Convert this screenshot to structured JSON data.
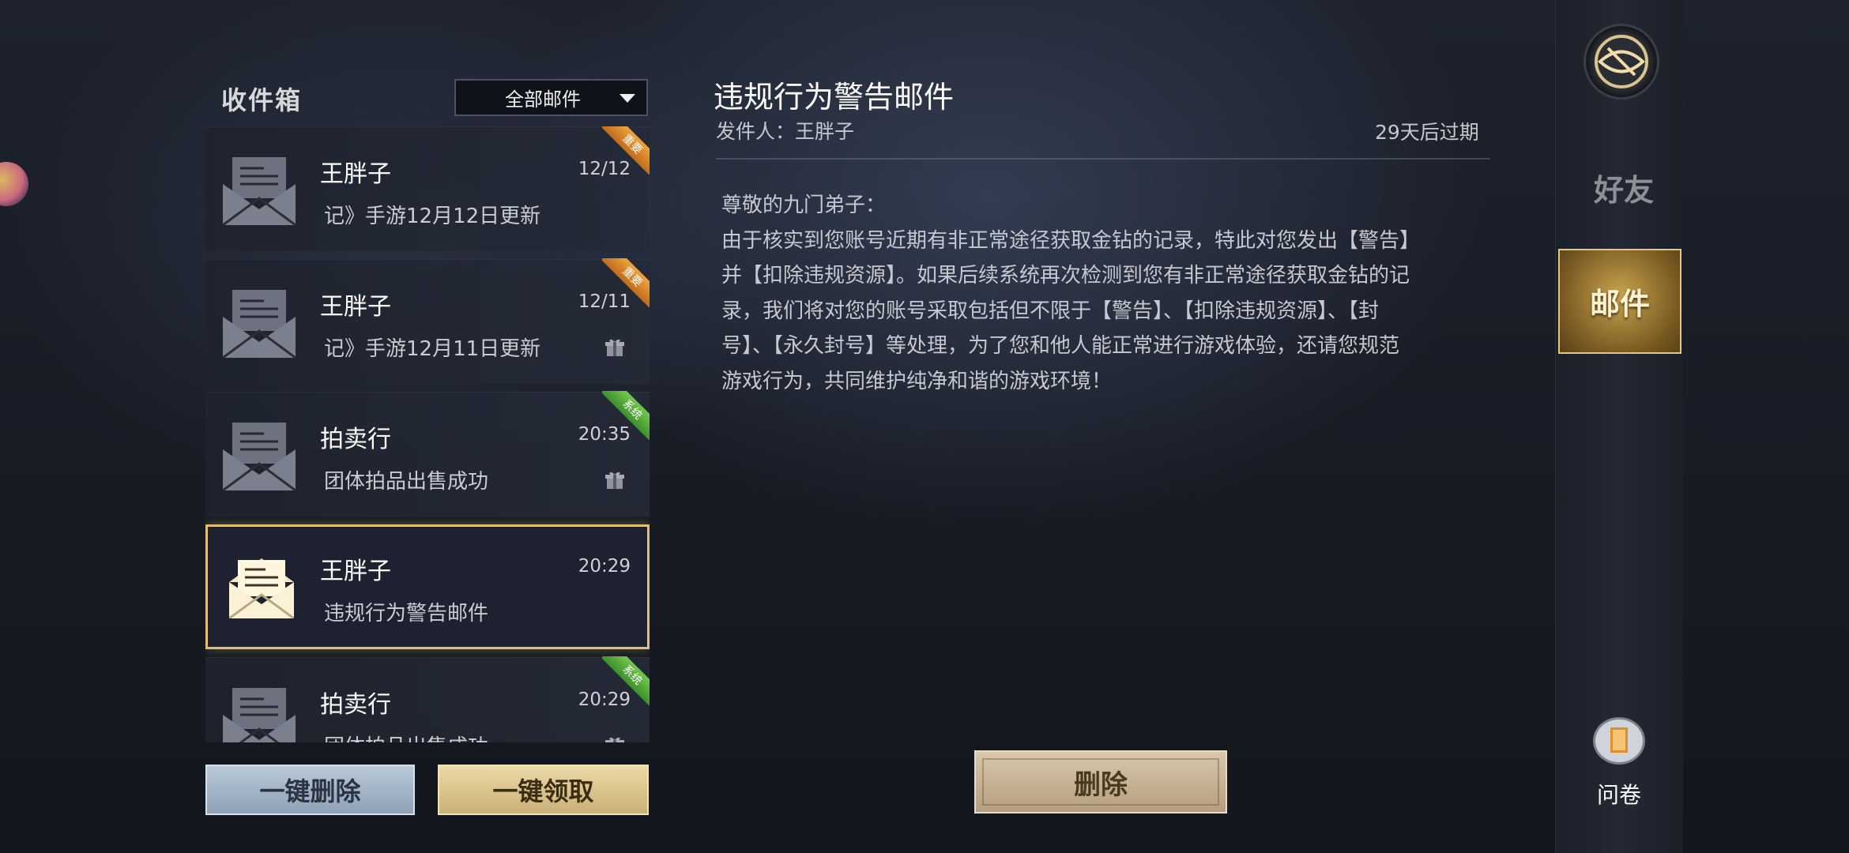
{
  "inbox": {
    "title": "收件箱",
    "filter_value": "全部邮件"
  },
  "mails": [
    {
      "sender": "王胖子",
      "time": "12/12",
      "subject": "记》手游12月12日更新",
      "tag": "重要",
      "tag_type": "important",
      "has_gift": false,
      "selected": false
    },
    {
      "sender": "王胖子",
      "time": "12/11",
      "subject": "记》手游12月11日更新",
      "tag": "重要",
      "tag_type": "important",
      "has_gift": true,
      "selected": false
    },
    {
      "sender": "拍卖行",
      "time": "20:35",
      "subject": "团体拍品出售成功",
      "tag": "系统",
      "tag_type": "system",
      "has_gift": true,
      "selected": false
    },
    {
      "sender": "王胖子",
      "time": "20:29",
      "subject": "违规行为警告邮件",
      "tag": "",
      "tag_type": "",
      "has_gift": false,
      "selected": true
    },
    {
      "sender": "拍卖行",
      "time": "20:29",
      "subject": "团体拍品出售成功",
      "tag": "系统",
      "tag_type": "system",
      "has_gift": true,
      "selected": false
    }
  ],
  "actions": {
    "delete_all": "一键删除",
    "claim_all": "一键领取",
    "delete": "删除"
  },
  "detail": {
    "title": "违规行为警告邮件",
    "from": "发件人：王胖子",
    "expire": "29天后过期",
    "body_lines": [
      "尊敬的九门弟子：",
      "由于核实到您账号近期有非正常途径获取金钻的记录，特此对您发出【警告】",
      "并【扣除违规资源】。如果后续系统再次检测到您有非正常途径获取金钻的记",
      "录，我们将对您的账号采取包括但不限于【警告】、【扣除违规资源】、【封",
      "号】、【永久封号】等处理，为了您和他人能正常进行游戏体验，还请您规范",
      "游戏行为，共同维护纯净和谐的游戏环境！"
    ]
  },
  "sidebar": {
    "friends": "好友",
    "mail": "邮件",
    "survey": "问卷"
  },
  "colors": {
    "selected_border": "#e2c072",
    "important_tag": "#e08a2c",
    "system_tag": "#5bb13d"
  }
}
